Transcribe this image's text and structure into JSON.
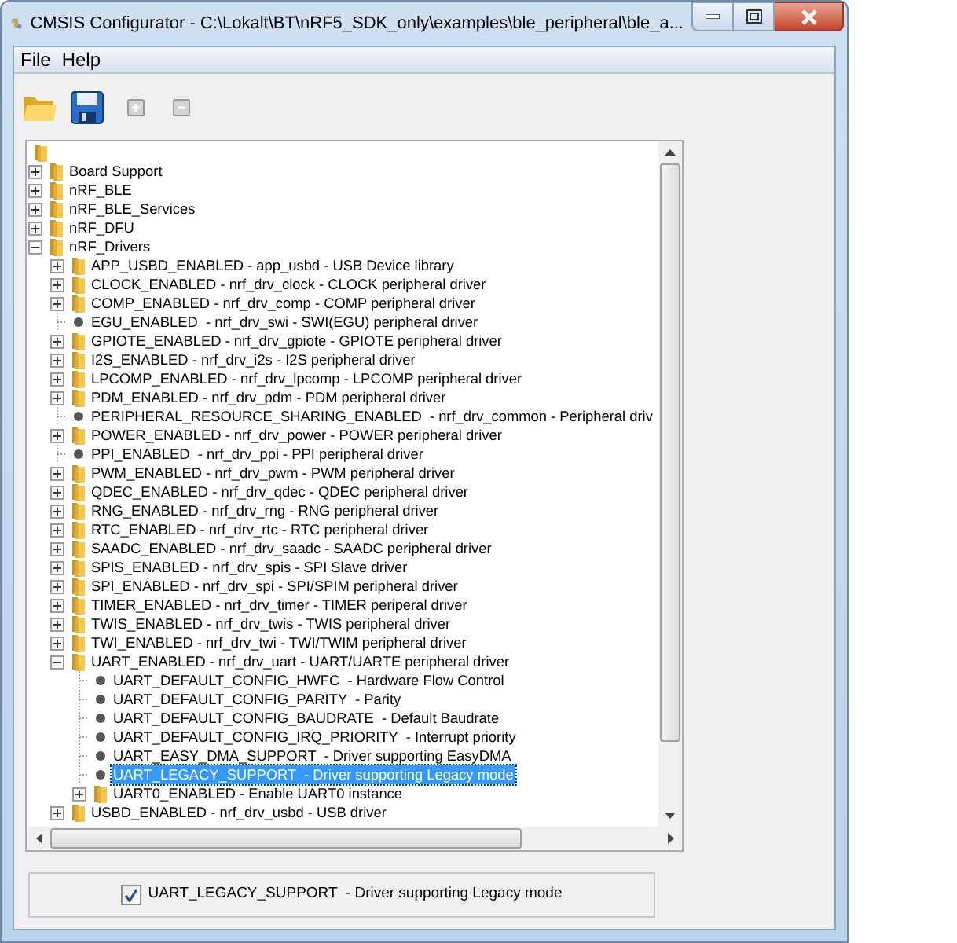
{
  "window": {
    "title": "CMSIS Configurator - C:\\Lokalt\\BT\\nRF5_SDK_only\\examples\\ble_peripheral\\ble_a..."
  },
  "menu": [
    {
      "label": "File"
    },
    {
      "label": "Help"
    }
  ],
  "tree": {
    "kind": "folder",
    "children": [
      {
        "label": "Board Support",
        "kind": "folder",
        "expanded": false,
        "selected": false
      },
      {
        "label": "nRF_BLE",
        "kind": "folder",
        "expanded": false,
        "selected": false
      },
      {
        "label": "nRF_BLE_Services",
        "kind": "folder",
        "expanded": false,
        "selected": false
      },
      {
        "label": "nRF_DFU",
        "kind": "folder",
        "expanded": false,
        "selected": false
      },
      {
        "label": "nRF_Drivers",
        "kind": "folder",
        "expanded": true,
        "selected": false,
        "children": [
          {
            "label": "APP_USBD_ENABLED - app_usbd - USB Device library",
            "kind": "folder",
            "expanded": false,
            "selected": false
          },
          {
            "label": "CLOCK_ENABLED - nrf_drv_clock - CLOCK peripheral driver",
            "kind": "folder",
            "expanded": false,
            "selected": false
          },
          {
            "label": "COMP_ENABLED - nrf_drv_comp - COMP peripheral driver",
            "kind": "folder",
            "expanded": false,
            "selected": false
          },
          {
            "label": "EGU_ENABLED  - nrf_drv_swi - SWI(EGU) peripheral driver",
            "kind": "option",
            "selected": false
          },
          {
            "label": "GPIOTE_ENABLED - nrf_drv_gpiote - GPIOTE peripheral driver",
            "kind": "folder",
            "expanded": false,
            "selected": false
          },
          {
            "label": "I2S_ENABLED - nrf_drv_i2s - I2S peripheral driver",
            "kind": "folder",
            "expanded": false,
            "selected": false
          },
          {
            "label": "LPCOMP_ENABLED - nrf_drv_lpcomp - LPCOMP peripheral driver",
            "kind": "folder",
            "expanded": false,
            "selected": false
          },
          {
            "label": "PDM_ENABLED - nrf_drv_pdm - PDM peripheral driver",
            "kind": "folder",
            "expanded": false,
            "selected": false
          },
          {
            "label": "PERIPHERAL_RESOURCE_SHARING_ENABLED  - nrf_drv_common - Peripheral driv",
            "kind": "option",
            "selected": false
          },
          {
            "label": "POWER_ENABLED - nrf_drv_power - POWER peripheral driver",
            "kind": "folder",
            "expanded": false,
            "selected": false
          },
          {
            "label": "PPI_ENABLED  - nrf_drv_ppi - PPI peripheral driver",
            "kind": "option",
            "selected": false
          },
          {
            "label": "PWM_ENABLED - nrf_drv_pwm - PWM peripheral driver",
            "kind": "folder",
            "expanded": false,
            "selected": false
          },
          {
            "label": "QDEC_ENABLED - nrf_drv_qdec - QDEC peripheral driver",
            "kind": "folder",
            "expanded": false,
            "selected": false
          },
          {
            "label": "RNG_ENABLED - nrf_drv_rng - RNG peripheral driver",
            "kind": "folder",
            "expanded": false,
            "selected": false
          },
          {
            "label": "RTC_ENABLED - nrf_drv_rtc - RTC peripheral driver",
            "kind": "folder",
            "expanded": false,
            "selected": false
          },
          {
            "label": "SAADC_ENABLED - nrf_drv_saadc - SAADC peripheral driver",
            "kind": "folder",
            "expanded": false,
            "selected": false
          },
          {
            "label": "SPIS_ENABLED - nrf_drv_spis - SPI Slave driver",
            "kind": "folder",
            "expanded": false,
            "selected": false
          },
          {
            "label": "SPI_ENABLED - nrf_drv_spi - SPI/SPIM peripheral driver",
            "kind": "folder",
            "expanded": false,
            "selected": false
          },
          {
            "label": "TIMER_ENABLED - nrf_drv_timer - TIMER periperal driver",
            "kind": "folder",
            "expanded": false,
            "selected": false
          },
          {
            "label": "TWIS_ENABLED - nrf_drv_twis - TWIS peripheral driver",
            "kind": "folder",
            "expanded": false,
            "selected": false
          },
          {
            "label": "TWI_ENABLED - nrf_drv_twi - TWI/TWIM peripheral driver",
            "kind": "folder",
            "expanded": false,
            "selected": false
          },
          {
            "label": "UART_ENABLED - nrf_drv_uart - UART/UARTE peripheral driver",
            "kind": "folder",
            "expanded": true,
            "selected": false,
            "children": [
              {
                "label": "UART_DEFAULT_CONFIG_HWFC  - Hardware Flow Control",
                "kind": "option",
                "selected": false
              },
              {
                "label": "UART_DEFAULT_CONFIG_PARITY  - Parity",
                "kind": "option",
                "selected": false
              },
              {
                "label": "UART_DEFAULT_CONFIG_BAUDRATE  - Default Baudrate",
                "kind": "option",
                "selected": false
              },
              {
                "label": "UART_DEFAULT_CONFIG_IRQ_PRIORITY  - Interrupt priority",
                "kind": "option",
                "selected": false
              },
              {
                "label": "UART_EASY_DMA_SUPPORT  - Driver supporting EasyDMA",
                "kind": "option",
                "selected": false
              },
              {
                "label": "UART_LEGACY_SUPPORT  - Driver supporting Legacy mode",
                "kind": "option",
                "selected": true
              },
              {
                "label": "UART0_ENABLED - Enable UART0 instance",
                "kind": "folder",
                "expanded": false,
                "selected": false
              }
            ]
          },
          {
            "label": "USBD_ENABLED - nrf_drv_usbd - USB driver",
            "kind": "folder",
            "expanded": false,
            "selected": false
          }
        ]
      }
    ]
  },
  "option_panel": {
    "label": "UART_LEGACY_SUPPORT  - Driver supporting Legacy mode",
    "checked": true
  }
}
